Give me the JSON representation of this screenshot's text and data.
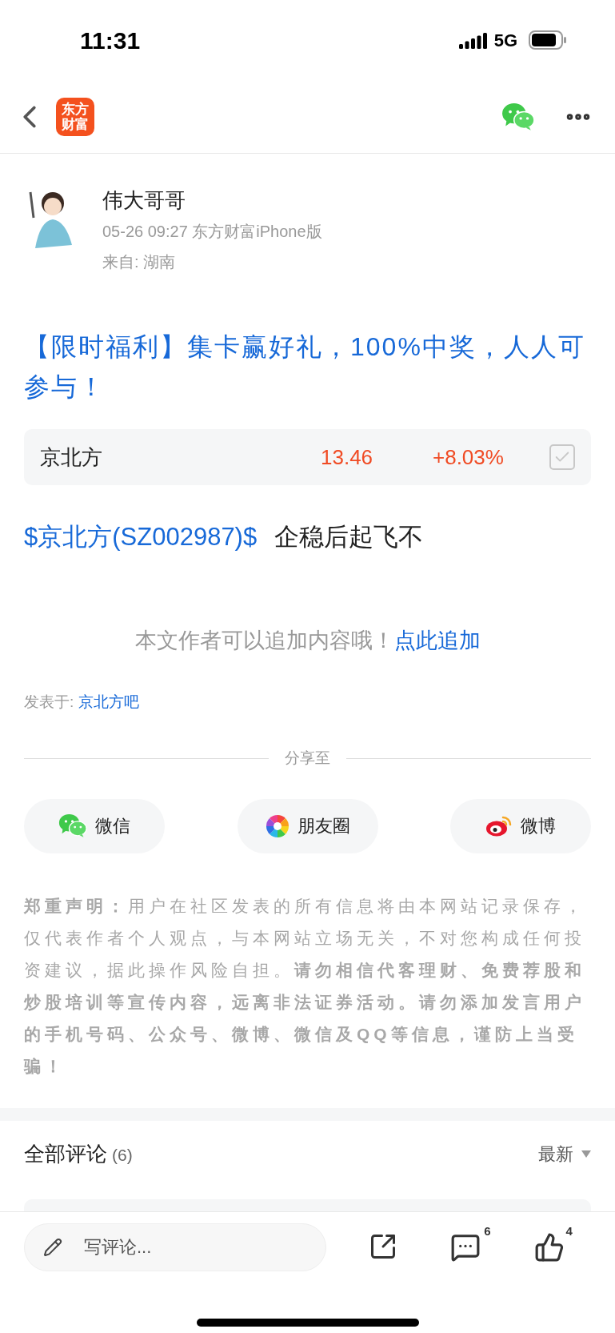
{
  "status_bar": {
    "time": "11:31",
    "network": "5G"
  },
  "nav": {
    "logo_lines": [
      "东方",
      "财富"
    ]
  },
  "author": {
    "name": "伟大哥哥",
    "meta": "05-26 09:27 东方财富iPhone版",
    "location": "来自: 湖南"
  },
  "post": {
    "title": "【限时福利】集卡赢好礼，100%中奖，人人可参与！",
    "stock": {
      "name": "京北方",
      "price": "13.46",
      "change": "+8.03%",
      "checked": false
    },
    "body_link": "$京北方(SZ002987)$",
    "body_text": "企稳后起飞不"
  },
  "append": {
    "text": "本文作者可以追加内容哦！",
    "link": "点此追加"
  },
  "posted_in": {
    "label": "发表于:",
    "link": "京北方吧"
  },
  "share": {
    "label": "分享至",
    "buttons": [
      {
        "kind": "wechat",
        "label": "微信"
      },
      {
        "kind": "moments",
        "label": "朋友圈"
      },
      {
        "kind": "weibo",
        "label": "微博"
      }
    ]
  },
  "disclaimer": "**郑重声明：**用户在社区发表的所有信息将由本网站记录保存，仅代表作者个人观点，与本网站立场无关，不对您构成任何投资建议，据此操作风险自担。**请勿相信代客理财、免费荐股和炒股培训等宣传内容，远离非法证券活动。请勿添加发言用户的手机号码、公众号、微博、微信及QQ等信息，谨防上当受骗！**",
  "comments": {
    "title": "全部评论",
    "count": "(6)",
    "sort": "最新"
  },
  "bottom_bar": {
    "placeholder": "写评论...",
    "comment_count": "6",
    "like_count": "4"
  }
}
